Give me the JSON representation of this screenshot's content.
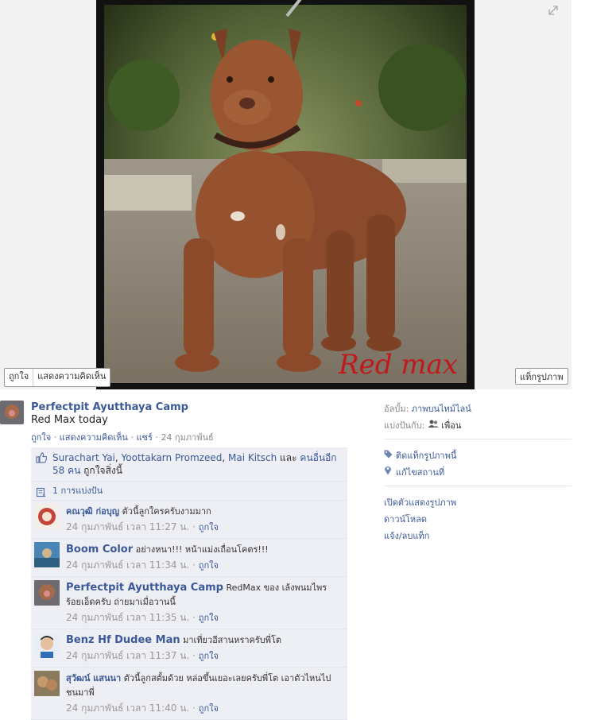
{
  "stage": {
    "watermark": "Red max",
    "buttons": {
      "like": "ถูกใจ",
      "comment": "แสดงความคิดเห็น",
      "tag": "แท็กรูปภาพ"
    }
  },
  "post": {
    "owner_name": "Perfectpit Ayutthaya Camp",
    "caption": "Red Max today",
    "meta": {
      "like": "ถูกใจ",
      "comment": "แสดงความคิดเห็น",
      "share": "แชร์",
      "date": "24 กุมภาพันธ์",
      "sep": " · "
    }
  },
  "likes": {
    "names": [
      "Surachart Yai",
      "Yoottakarn Promzeed",
      "Mai Kitsch"
    ],
    "comma": ", ",
    "and": "และ",
    "others_link": "คนอื่นอีก 58 คน",
    "suffix": "ถูกใจสิ่งนี้"
  },
  "shares": {
    "label": "1 การแบ่งปัน"
  },
  "comments": [
    {
      "name": "คณวุฒิ ก่อบุญ",
      "text": "ตัวนี้ลูกใครครับงามมาก",
      "time": "24 กุมภาพันธ์ เวลา 11:27 น.",
      "like": "ถูกใจ",
      "sep": " · "
    },
    {
      "name": "Boom Color",
      "text": "อย่างหนา!!! หน้าแม่งเถื่อนโคตร!!!",
      "time": "24 กุมภาพันธ์ เวลา 11:34 น.",
      "like": "ถูกใจ",
      "sep": " · "
    },
    {
      "name": "Perfectpit Ayutthaya Camp",
      "text": "RedMax ของ เล้งพนมไพร ร้อยเอ็ดครับ ถ่ายมาเมื่อวานนี้",
      "time": "24 กุมภาพันธ์ เวลา 11:35 น.",
      "like": "ถูกใจ",
      "sep": " · "
    },
    {
      "name": "Benz Hf Dudee Man",
      "text": "มาเที่ยวอีสานหราครับพี่โต",
      "time": "24 กุมภาพันธ์ เวลา 11:37 น.",
      "like": "ถูกใจ",
      "sep": " · "
    },
    {
      "name": "สุวัฒน์ แสนนา",
      "text": "ตัวนี้ลูกสตั้มด้วย หล่อขึ้นเยอะเลยครับพี่โต เอาตัวไหนไปชนมาพี่",
      "time": "24 กุมภาพันธ์ เวลา 11:40 น.",
      "like": "ถูกใจ",
      "sep": " · "
    }
  ],
  "sidebar": {
    "album_label": "อัลบั้ม:",
    "album_value": "ภาพบนไทม์ไลน์",
    "shared_label": "แบ่งปันกับ:",
    "shared_value": "เพื่อน",
    "tag_photo": "ติดแท็กรูปภาพนี้",
    "edit_location": "แก้ไขสถานที่",
    "open_viewer": "เปิดตัวแสดงรูปภาพ",
    "download": "ดาวน์โหลด",
    "report": "แจ้ง/ลบแท็ก"
  },
  "icons": [
    "expand-icon",
    "thumbs-up-icon",
    "share-icon",
    "friends-icon",
    "tag-icon",
    "location-pin-icon"
  ],
  "colors": {
    "link": "#3b5998",
    "ufi_bg": "#edeff4",
    "watermark": "#c0181b"
  }
}
